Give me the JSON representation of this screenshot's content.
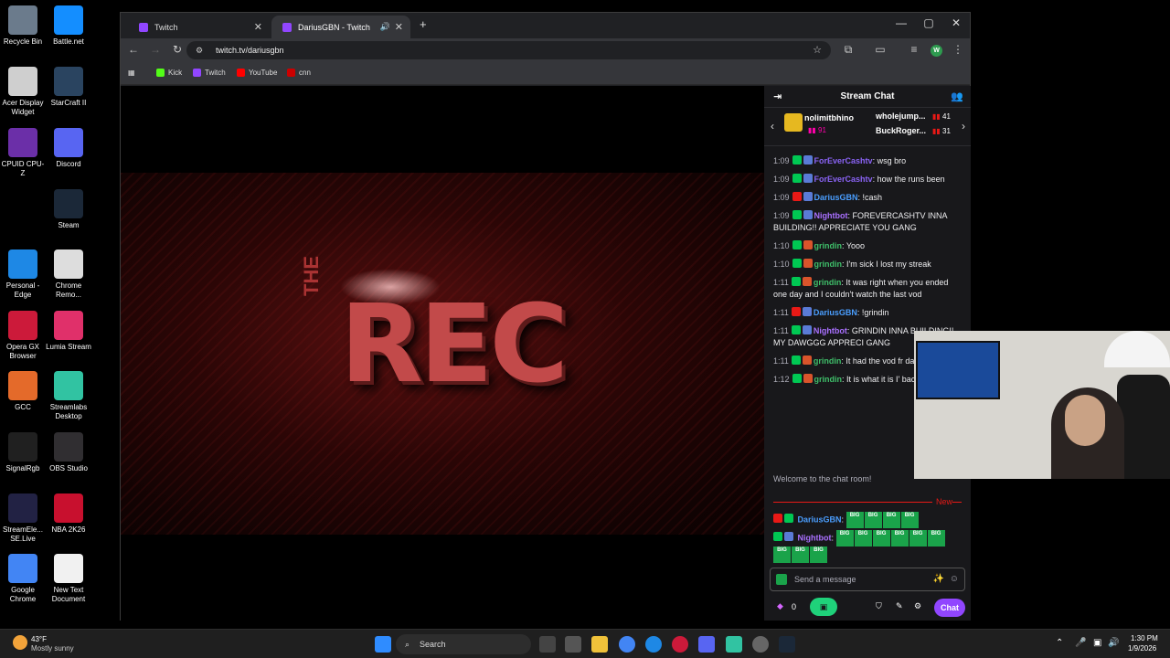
{
  "desktop_icons": [
    {
      "label": "Recycle Bin",
      "color": "#6b7b8c"
    },
    {
      "label": "Battle.net",
      "color": "#148eff"
    },
    {
      "label": "Acer Display Widget",
      "color": "#cfcfcf"
    },
    {
      "label": "StarCraft II",
      "color": "#2a4460"
    },
    {
      "label": "CPUID CPU-Z",
      "color": "#6b2fa8"
    },
    {
      "label": "Discord",
      "color": "#5865f2"
    },
    {
      "label": "Steam",
      "color": "#1b2838"
    },
    {
      "label": "Personal - Edge",
      "color": "#1e88e5"
    },
    {
      "label": "Chrome Remo...",
      "color": "#dddddd"
    },
    {
      "label": "Opera GX Browser",
      "color": "#cc1a3a"
    },
    {
      "label": "Lumia Stream",
      "color": "#e0306a"
    },
    {
      "label": "GCC",
      "color": "#e46a2a"
    },
    {
      "label": "Streamlabs Desktop",
      "color": "#31c3a2"
    },
    {
      "label": "SignalRgb",
      "color": "#202020"
    },
    {
      "label": "OBS Studio",
      "color": "#302e31"
    },
    {
      "label": "StreamEle... SE.Live",
      "color": "#222244"
    },
    {
      "label": "NBA 2K26",
      "color": "#c8102e"
    },
    {
      "label": "Google Chrome",
      "color": "#4285f4"
    },
    {
      "label": "New Text Document",
      "color": "#f1f1f1"
    }
  ],
  "browser": {
    "tabs": [
      {
        "label": "Twitch"
      },
      {
        "label": "DariusGBN - Twitch"
      }
    ],
    "new_tab": "+",
    "url": "twitch.tv/dariusgbn",
    "bookmarks": [
      {
        "label": "Kick",
        "color": "#53fc18"
      },
      {
        "label": "Twitch",
        "color": "#9146ff"
      },
      {
        "label": "YouTube",
        "color": "#ff0000"
      },
      {
        "label": "cnn",
        "color": "#cc0000"
      }
    ],
    "profile_initial": "W"
  },
  "video": {
    "logo_small": "THE",
    "logo_big": "REC"
  },
  "chat": {
    "title": "Stream Chat",
    "hype": {
      "top_user": "nolimitbhino",
      "top_count": "91",
      "second_user": "wholejump...",
      "second_count": "41",
      "third_user": "BuckRoger...",
      "third_count": "31"
    },
    "messages": [
      {
        "time": "1:09",
        "user": "ForEverCashtv",
        "color": "#8a63f5",
        "text": ": wsg bro"
      },
      {
        "time": "1:09",
        "user": "ForEverCashtv",
        "color": "#8a63f5",
        "text": ": how the runs been"
      },
      {
        "time": "1:09",
        "user": "DariusGBN",
        "color": "#4a9eff",
        "text": ": !cash"
      },
      {
        "time": "1:09",
        "user": "Nightbot",
        "color": "#a970ff",
        "text": ": FOREVERCASHTV INNA BUILDING!! APPRECIATE YOU GANG"
      },
      {
        "time": "1:10",
        "user": "grindin",
        "color": "#3fbf6a",
        "text": ": Yooo"
      },
      {
        "time": "1:10",
        "user": "grindin",
        "color": "#3fbf6a",
        "text": ": I'm sick I lost my streak"
      },
      {
        "time": "1:11",
        "user": "grindin",
        "color": "#3fbf6a",
        "text": ": It was right when you ended one day and I couldn't watch the last vod"
      },
      {
        "time": "1:11",
        "user": "DariusGBN",
        "color": "#4a9eff",
        "text": ": !grindin"
      },
      {
        "time": "1:11",
        "user": "Nightbot",
        "color": "#a970ff",
        "text": ": GRINDIN INNA BUILDING!! MY DAWGGG APPRECI GANG"
      },
      {
        "time": "1:11",
        "user": "grindin",
        "color": "#3fbf6a",
        "text": ": It had the vod fr days prior"
      },
      {
        "time": "1:12",
        "user": "grindin",
        "color": "#3fbf6a",
        "text": ": It is what it is I' back up again"
      }
    ],
    "welcome": "Welcome to the chat room!",
    "new_label": "New",
    "recent": [
      {
        "user": "DariusGBN",
        "color": "#4a9eff",
        "emote_text": "BIG"
      },
      {
        "user": "Nightbot",
        "color": "#a970ff",
        "emote_text": "BIG"
      }
    ],
    "emote_label": "BIG",
    "input_placeholder": "Send a message",
    "points": "0",
    "chat_button": "Chat"
  },
  "taskbar": {
    "weather_temp": "43°F",
    "weather_desc": "Mostly sunny",
    "search_label": "Search",
    "time": "1:30 PM",
    "date": "1/9/2026"
  }
}
